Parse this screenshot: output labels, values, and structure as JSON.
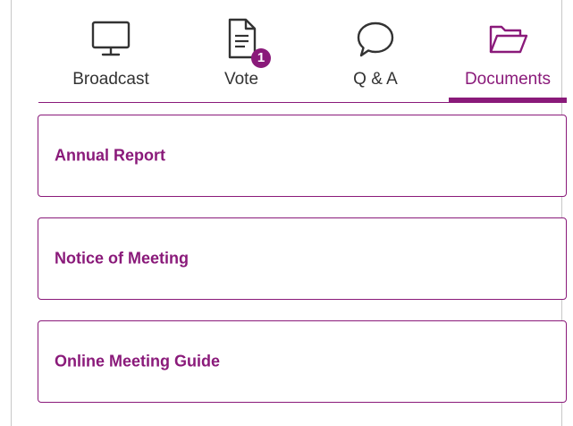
{
  "tabs": [
    {
      "label": "Broadcast",
      "icon": "monitor-icon",
      "active": false
    },
    {
      "label": "Vote",
      "icon": "document-icon",
      "active": false,
      "badge": "1"
    },
    {
      "label": "Q & A",
      "icon": "speech-bubble-icon",
      "active": false
    },
    {
      "label": "Documents",
      "icon": "folder-open-icon",
      "active": true
    }
  ],
  "documents": [
    {
      "title": "Annual Report"
    },
    {
      "title": "Notice of Meeting"
    },
    {
      "title": "Online Meeting Guide"
    }
  ],
  "colors": {
    "accent": "#8a1a7a",
    "text": "#333333",
    "border": "#c8c8c8"
  }
}
